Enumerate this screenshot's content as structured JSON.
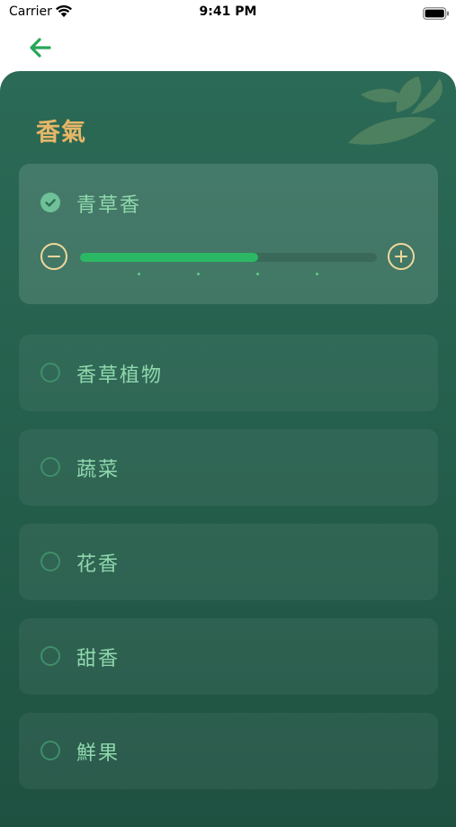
{
  "status_bar": {
    "carrier": "Carrier",
    "time": "9:41 PM"
  },
  "header": {
    "back_icon": "arrow-left-icon",
    "accent_color": "#28a559"
  },
  "panel": {
    "title": "香氣",
    "title_color": "#e7b667",
    "options": [
      {
        "label": "青草香",
        "selected": true,
        "intensity_percent": 60,
        "intensity_steps": 5
      },
      {
        "label": "香草植物",
        "selected": false
      },
      {
        "label": "蔬菜",
        "selected": false
      },
      {
        "label": "花香",
        "selected": false
      },
      {
        "label": "甜香",
        "selected": false
      },
      {
        "label": "鮮果",
        "selected": false
      }
    ]
  }
}
